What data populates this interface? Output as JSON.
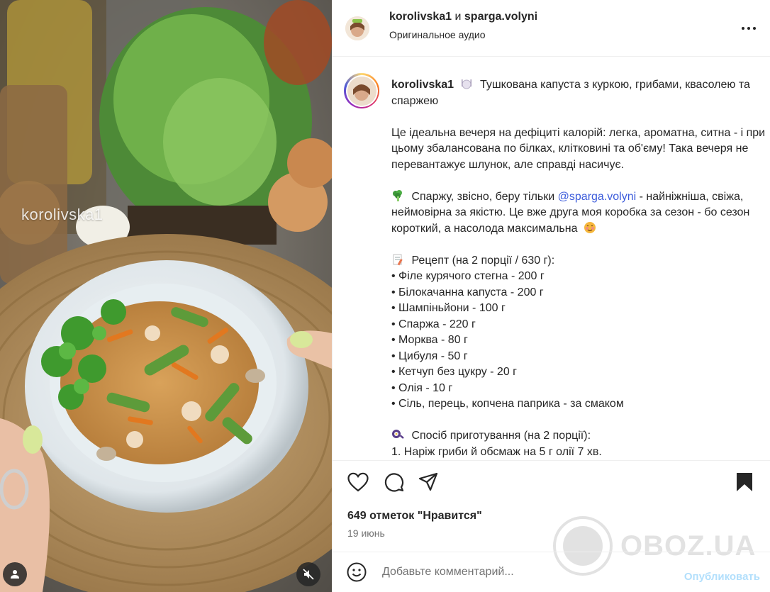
{
  "media": {
    "watermark_text": "korolivska1"
  },
  "header": {
    "user1": "korolivska1",
    "and_word": "и",
    "user2": "sparga.volyni",
    "audio": "Оригинальное аудио"
  },
  "caption": {
    "username": "korolivska1",
    "title": "Тушкована капуста з куркою, грибами, квасолею та спаржею",
    "intro": "Це ідеальна вечеря на дефіциті калорій: легка, ароматна, ситна - і при цьому збалансована по білках, клітковині та об'єму! Така вечеря не перевантажує шлунок, але справді насичує.",
    "sparga_pre": "Спаржу, звісно, беру тільки",
    "sparga_mention": "@sparga.volyni",
    "sparga_post": "- найніжніша, свіжа, неймовірна за якістю. Це вже друга моя коробка за сезон - бо сезон короткий, а насолода максимальна",
    "recipe_title": "Рецепт (на 2 порції / 630 г):",
    "ingredients": [
      "• Філе курячого стегна - 200 г",
      "• Білокачанна капуста - 200 г",
      "• Шампіньйони - 100 г",
      "• Спаржа - 220 г",
      "• Морква - 80 г",
      "• Цибуля - 50 г",
      "• Кетчуп без цукру - 20 г",
      "• Олія - 10 г",
      "• Сіль, перець, копчена паприка - за смаком"
    ],
    "method_title": "Спосіб приготування (на 2 порції):",
    "step1": "1. Наріж гриби й обсмаж на 5 г олії 7 хв."
  },
  "footer": {
    "likes": "649 отметок \"Нравится\"",
    "date": "19 июнь",
    "comment_placeholder": "Добавьте комментарий...",
    "publish": "Опубликовать"
  },
  "brand_watermark": "OBOZ.UA",
  "icons": {
    "like": "heart-icon",
    "comment": "comment-icon",
    "share": "share-icon",
    "save": "bookmark-icon",
    "emoji": "emoji-icon",
    "more": "more-icon",
    "mute": "muted-speaker-icon",
    "tag": "user-tag-icon"
  }
}
